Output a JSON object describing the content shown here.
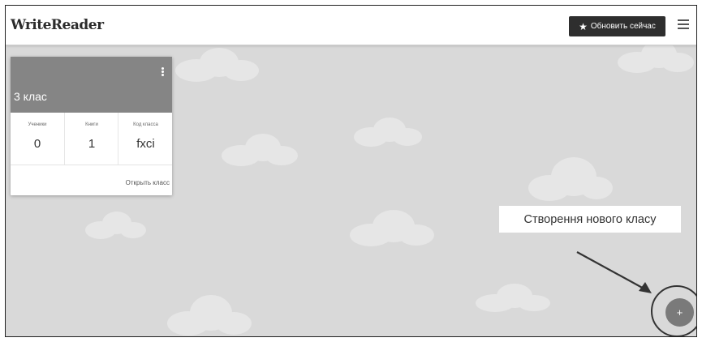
{
  "header": {
    "logo_text": "WriteReader",
    "upgrade_label": "Обновить сейчас"
  },
  "class_card": {
    "title": "3 клас",
    "stats": [
      {
        "label": "Ученики",
        "value": "0"
      },
      {
        "label": "Книги",
        "value": "1"
      },
      {
        "label": "Код класса",
        "value": "fxci"
      }
    ],
    "open_link": "Открыть класс"
  },
  "annotation": {
    "callout_text": "Створення нового класу"
  },
  "fab": {
    "icon": "plus-icon",
    "symbol": "+"
  },
  "colors": {
    "background": "#d9d9d9",
    "card_header": "#858585",
    "button": "#2e2e2e",
    "fab": "#7a7a7a"
  }
}
